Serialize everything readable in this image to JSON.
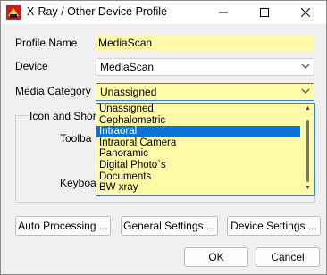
{
  "window": {
    "title": "X-Ray / Other Device Profile"
  },
  "form": {
    "profile_name_label": "Profile Name",
    "profile_name_value": "MediaScan",
    "device_label": "Device",
    "device_value": "MediaScan",
    "media_category_label": "Media Category",
    "media_category_value": "Unassigned"
  },
  "group": {
    "legend": "Icon and Shortc",
    "toolbar_label": "Toolba",
    "keyboard_label": "Keyboa"
  },
  "dropdown": {
    "options": [
      "Unassigned",
      "Cephalometric",
      "Intraoral",
      "Intraoral Camera",
      "Panoramic",
      "Digital Photo`s",
      "Documents",
      "BW xray"
    ],
    "selected_index": 2
  },
  "buttons": {
    "auto_processing": "Auto Processing ...",
    "general_settings": "General Settings ...",
    "device_settings": "Device Settings ...",
    "ok": "OK",
    "cancel": "Cancel"
  },
  "colors": {
    "field_yellow": "#fffaa8",
    "selection_blue": "#0a73d6",
    "focus_blue": "#3c7fd1"
  }
}
